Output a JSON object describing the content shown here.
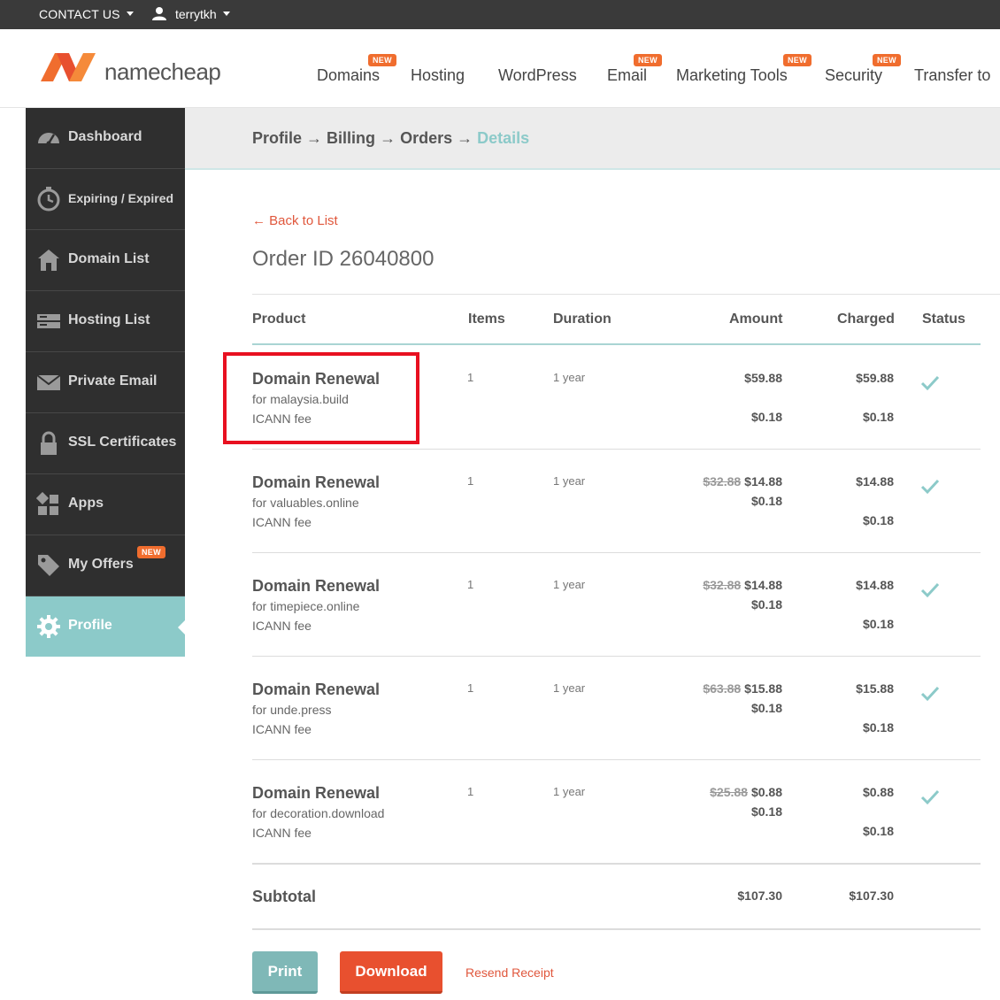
{
  "topbar": {
    "contact": "CONTACT US",
    "username": "terrytkh"
  },
  "brand": {
    "name": "namecheap"
  },
  "nav": [
    {
      "label": "Domains",
      "badge": "NEW"
    },
    {
      "label": "Hosting",
      "badge": ""
    },
    {
      "label": "WordPress",
      "badge": ""
    },
    {
      "label": "Email",
      "badge": "NEW"
    },
    {
      "label": "Marketing Tools",
      "badge": "NEW"
    },
    {
      "label": "Security",
      "badge": "NEW"
    },
    {
      "label": "Transfer to",
      "badge": ""
    }
  ],
  "sidebar": [
    {
      "label": "Dashboard",
      "icon": "speedometer-icon"
    },
    {
      "label": "Expiring / Expired",
      "icon": "clock-icon"
    },
    {
      "label": "Domain List",
      "icon": "home-icon"
    },
    {
      "label": "Hosting List",
      "icon": "server-icon"
    },
    {
      "label": "Private Email",
      "icon": "envelope-icon"
    },
    {
      "label": "SSL Certificates",
      "icon": "lock-icon"
    },
    {
      "label": "Apps",
      "icon": "apps-icon"
    },
    {
      "label": "My Offers",
      "icon": "tag-icon",
      "badge": "NEW"
    },
    {
      "label": "Profile",
      "icon": "gear-icon",
      "active": true
    }
  ],
  "breadcrumb": {
    "profile": "Profile",
    "billing": "Billing",
    "orders": "Orders",
    "details": "Details",
    "sep": "→"
  },
  "back_link": "← Back to List",
  "order_title": "Order ID 26040800",
  "columns": {
    "product": "Product",
    "items": "Items",
    "duration": "Duration",
    "amount": "Amount",
    "charged": "Charged",
    "status": "Status"
  },
  "orders": [
    {
      "product": "Domain Renewal",
      "domain": "for malaysia.build",
      "fee_label": "ICANN fee",
      "items": "1",
      "duration": "1 year",
      "old_price": "",
      "price": "$59.88",
      "fee": "$0.18",
      "charged": "$59.88",
      "charged_fee": "$0.18"
    },
    {
      "product": "Domain Renewal",
      "domain": "for valuables.online",
      "fee_label": "ICANN fee",
      "items": "1",
      "duration": "1 year",
      "old_price": "$32.88",
      "price": "$14.88",
      "fee": "$0.18",
      "charged": "$14.88",
      "charged_fee": "$0.18"
    },
    {
      "product": "Domain Renewal",
      "domain": "for timepiece.online",
      "fee_label": "ICANN fee",
      "items": "1",
      "duration": "1 year",
      "old_price": "$32.88",
      "price": "$14.88",
      "fee": "$0.18",
      "charged": "$14.88",
      "charged_fee": "$0.18"
    },
    {
      "product": "Domain Renewal",
      "domain": "for unde.press",
      "fee_label": "ICANN fee",
      "items": "1",
      "duration": "1 year",
      "old_price": "$63.88",
      "price": "$15.88",
      "fee": "$0.18",
      "charged": "$15.88",
      "charged_fee": "$0.18"
    },
    {
      "product": "Domain Renewal",
      "domain": "for decoration.download",
      "fee_label": "ICANN fee",
      "items": "1",
      "duration": "1 year",
      "old_price": "$25.88",
      "price": "$0.88",
      "fee": "$0.18",
      "charged": "$0.88",
      "charged_fee": "$0.18"
    }
  ],
  "subtotal": {
    "label": "Subtotal",
    "amount": "$107.30",
    "charged": "$107.30"
  },
  "buttons": {
    "print": "Print",
    "download": "Download",
    "resend": "Resend Receipt"
  },
  "colors": {
    "accent_teal": "#8ccac9",
    "brand_orange": "#f06d2e",
    "download_red": "#e8502f",
    "highlight_red": "#e81020"
  }
}
